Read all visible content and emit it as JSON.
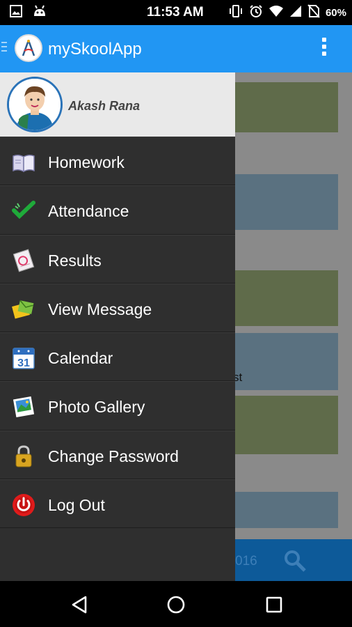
{
  "status_bar": {
    "time": "11:53 AM",
    "battery": "60%",
    "left_icons": [
      "image-icon",
      "android-icon"
    ],
    "right_icons": [
      "vibrate-icon",
      "alarm-icon",
      "wifi-icon",
      "signal-icon",
      "no-sim-icon"
    ]
  },
  "app_bar": {
    "title": "mySkoolApp",
    "color": "#2196F3"
  },
  "profile": {
    "name": "Akash Rana"
  },
  "menu": {
    "items": [
      {
        "label": "Homework",
        "icon": "book-icon"
      },
      {
        "label": "Attendance",
        "icon": "checkmark-icon"
      },
      {
        "label": "Results",
        "icon": "report-card-icon"
      },
      {
        "label": "View Message",
        "icon": "message-icon"
      },
      {
        "label": "Calendar",
        "icon": "calendar-icon"
      },
      {
        "label": "Photo Gallery",
        "icon": "photo-gallery-icon"
      },
      {
        "label": "Change Password",
        "icon": "padlock-icon"
      },
      {
        "label": "Log Out",
        "icon": "power-icon"
      }
    ]
  },
  "calendar_icon_day": "31",
  "background": {
    "partial_text": "st",
    "bottom_year": "016"
  }
}
